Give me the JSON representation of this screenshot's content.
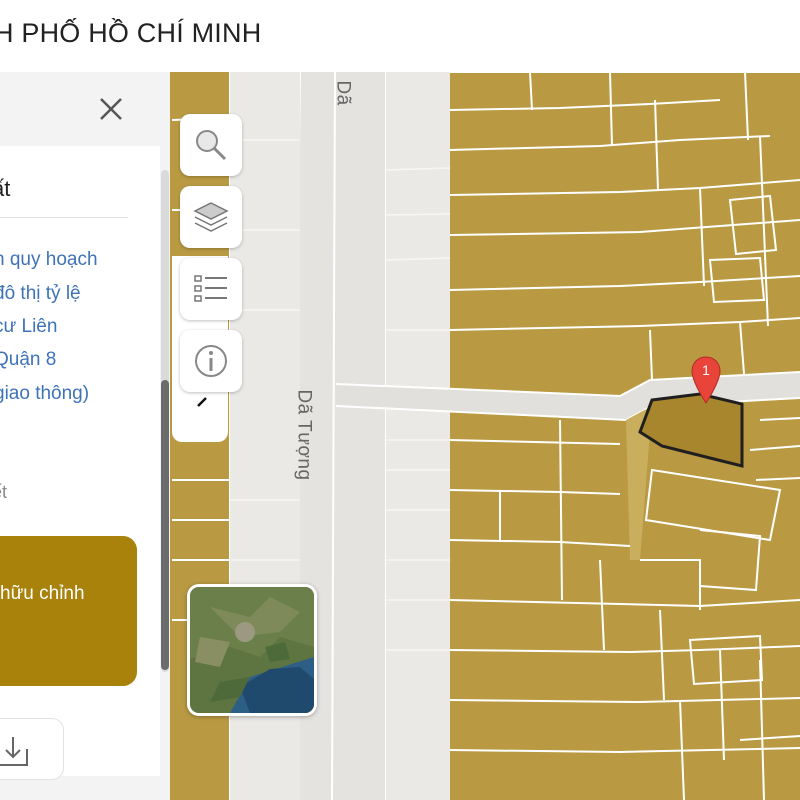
{
  "header": {
    "title": "H PHỐ HỒ CHÍ MINH"
  },
  "panel": {
    "heading": "ất",
    "links": [
      "n quy hoạch",
      " đô thị tỷ lệ",
      "cư Liên",
      "Quận 8",
      "giao thông)"
    ],
    "muted": "ết",
    "cta_label": "hữu chỉnh"
  },
  "map": {
    "streets": [
      {
        "name": "Dã Tượng"
      },
      {
        "name": "Dã"
      }
    ],
    "marker_label": "1",
    "colors": {
      "parcel": "#b99a43",
      "road": "#e4e2df",
      "selected": "#a8862e",
      "marker": "#e8443a",
      "panel_cta": "#a8820a",
      "link": "#3f73b8"
    }
  },
  "icons": {
    "close": "close-icon",
    "tools": [
      "search-icon",
      "layers-icon",
      "list-icon",
      "info-icon"
    ],
    "download": "download-icon"
  }
}
